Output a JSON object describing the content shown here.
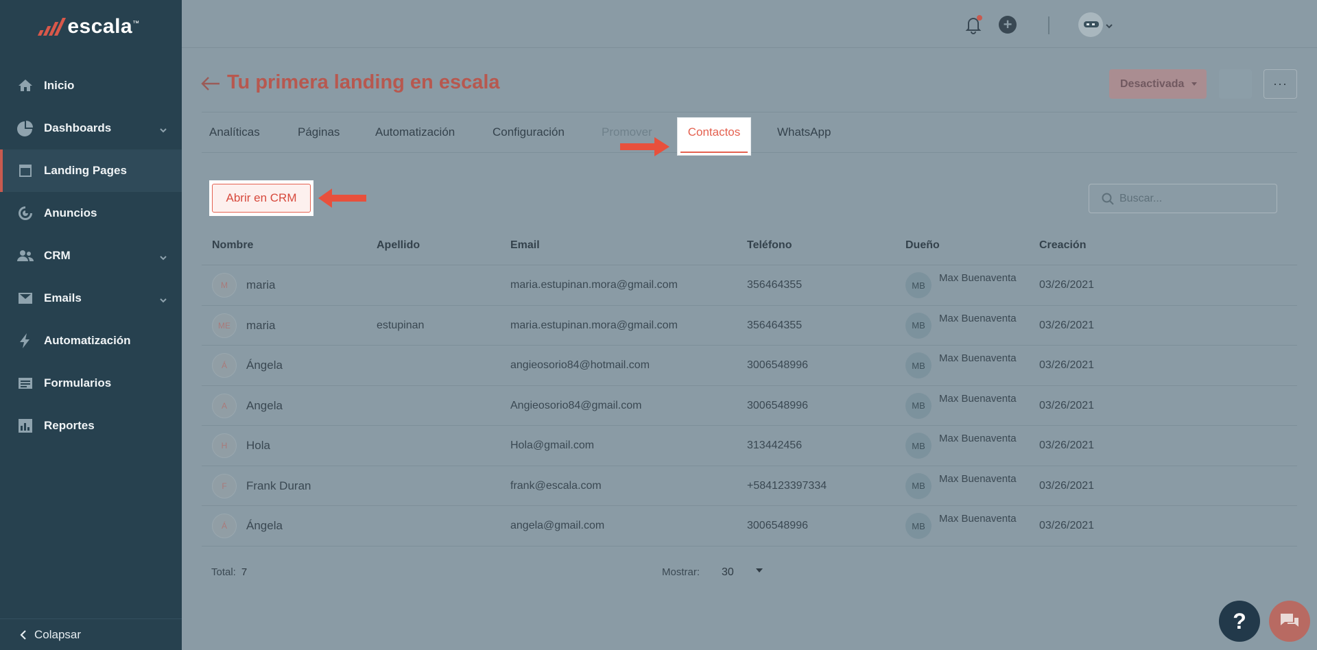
{
  "brand": {
    "name": "escala",
    "tm": "™",
    "accent": "#d9584a"
  },
  "sidebar": {
    "items": [
      {
        "label": "Inicio",
        "icon": "home-icon"
      },
      {
        "label": "Dashboards",
        "icon": "pie-chart-icon",
        "expandable": true
      },
      {
        "label": "Landing Pages",
        "icon": "window-icon",
        "active": true
      },
      {
        "label": "Anuncios",
        "icon": "target-icon"
      },
      {
        "label": "CRM",
        "icon": "users-icon",
        "expandable": true
      },
      {
        "label": "Emails",
        "icon": "envelope-icon",
        "expandable": true
      },
      {
        "label": "Automatización",
        "icon": "lightning-icon"
      },
      {
        "label": "Formularios",
        "icon": "form-icon"
      },
      {
        "label": "Reportes",
        "icon": "bar-chart-icon"
      }
    ],
    "collapse_label": "Colapsar"
  },
  "topbar": {
    "icons": [
      "bell-icon",
      "plus-circle-icon",
      "robot-avatar-icon"
    ]
  },
  "header": {
    "title": "Tu primera landing en escala",
    "status_label": "Desactivada"
  },
  "tabs": [
    {
      "label": "Analíticas"
    },
    {
      "label": "Páginas"
    },
    {
      "label": "Automatización"
    },
    {
      "label": "Configuración"
    },
    {
      "label": "Promover"
    },
    {
      "label": "Contactos",
      "active": true
    },
    {
      "label": "WhatsApp"
    }
  ],
  "actions": {
    "open_crm_label": "Abrir en CRM"
  },
  "search": {
    "placeholder": "Buscar..."
  },
  "table": {
    "columns": [
      "Nombre",
      "Apellido",
      "Email",
      "Teléfono",
      "Dueño",
      "Creación"
    ],
    "rows": [
      {
        "initials": "M",
        "name": "maria",
        "surname": "",
        "email": "maria.estupinan.mora@gmail.com",
        "phone": "356464355",
        "owner_initials": "MB",
        "owner": "Max Buenaventa",
        "created": "03/26/2021"
      },
      {
        "initials": "ME",
        "name": "maria",
        "surname": "estupinan",
        "email": "maria.estupinan.mora@gmail.com",
        "phone": "356464355",
        "owner_initials": "MB",
        "owner": "Max Buenaventa",
        "created": "03/26/2021"
      },
      {
        "initials": "Á",
        "name": "Ángela",
        "surname": "",
        "email": "angieosorio84@hotmail.com",
        "phone": "3006548996",
        "owner_initials": "MB",
        "owner": "Max Buenaventa",
        "created": "03/26/2021"
      },
      {
        "initials": "A",
        "name": "Angela",
        "surname": "",
        "email": "Angieosorio84@gmail.com",
        "phone": "3006548996",
        "owner_initials": "MB",
        "owner": "Max Buenaventa",
        "created": "03/26/2021"
      },
      {
        "initials": "H",
        "name": "Hola",
        "surname": "",
        "email": "Hola@gmail.com",
        "phone": "313442456",
        "owner_initials": "MB",
        "owner": "Max Buenaventa",
        "created": "03/26/2021"
      },
      {
        "initials": "F",
        "name": "Frank Duran",
        "surname": "",
        "email": "frank@escala.com",
        "phone": "+584123397334",
        "owner_initials": "MB",
        "owner": "Max Buenaventa",
        "created": "03/26/2021"
      },
      {
        "initials": "Á",
        "name": "Ángela",
        "surname": "",
        "email": "angela@gmail.com",
        "phone": "3006548996",
        "owner_initials": "MB",
        "owner": "Max Buenaventa",
        "created": "03/26/2021"
      }
    ]
  },
  "footer": {
    "total_label": "Total:",
    "total_value": "7",
    "show_label": "Mostrar:",
    "show_value": "30"
  },
  "floating": {
    "help_label": "?"
  },
  "colors": {
    "highlight": "#e4604f",
    "sidebar": "#27414f",
    "overlay": "#8a9ba5"
  }
}
